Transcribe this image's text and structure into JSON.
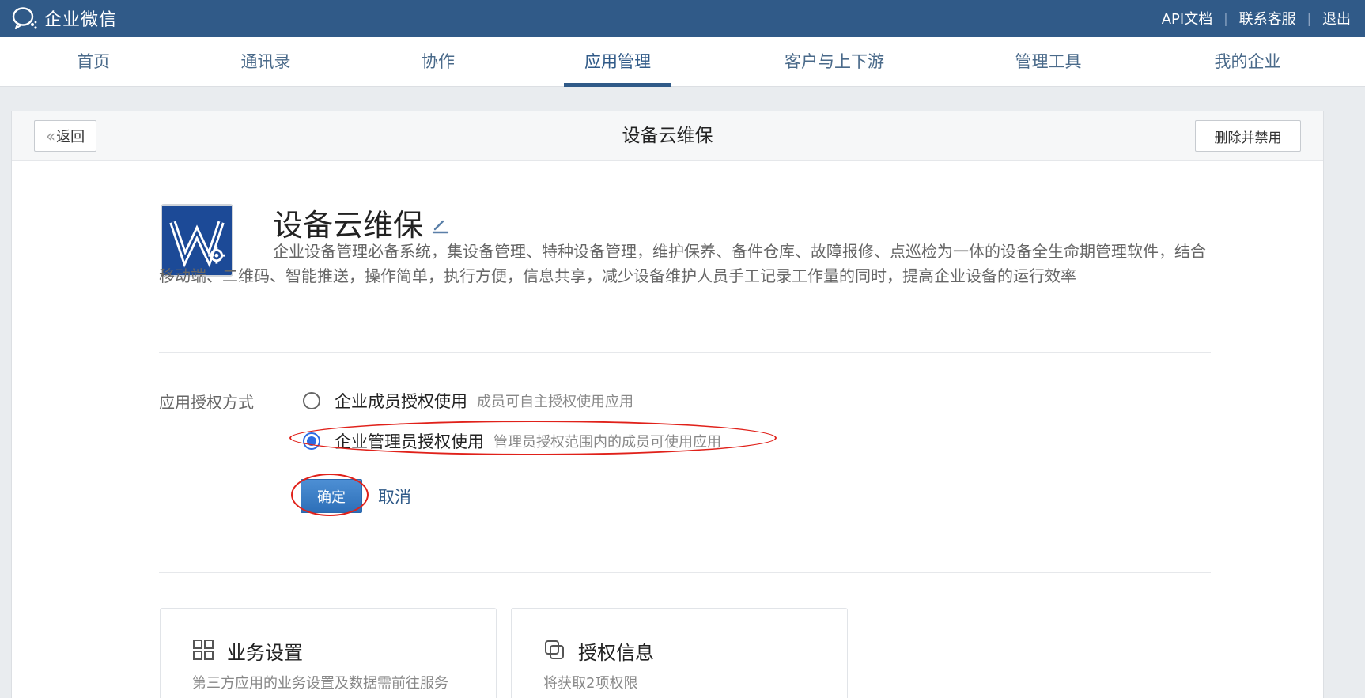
{
  "topbar": {
    "logo_text": "企业微信",
    "links": [
      "API文档",
      "联系客服",
      "退出"
    ]
  },
  "nav": {
    "items": [
      "首页",
      "通讯录",
      "协作",
      "应用管理",
      "客户与上下游",
      "管理工具",
      "我的企业"
    ],
    "active": "应用管理"
  },
  "header": {
    "back_label": "返回",
    "title": "设备云维保",
    "delete_label": "删除并禁用"
  },
  "app": {
    "name": "设备云维保",
    "description": "企业设备管理必备系统，集设备管理、特种设备管理，维护保养、备件仓库、故障报修、点巡检为一体的设备全生命期管理软件，结合移动端、二维码、智能推送，操作简单，执行方便，信息共享，减少设备维护人员手工记录工作量的同时，提高企业设备的运行效率"
  },
  "auth": {
    "label": "应用授权方式",
    "options": [
      {
        "title": "企业成员授权使用",
        "hint": "成员可自主授权使用应用",
        "checked": false
      },
      {
        "title": "企业管理员授权使用",
        "hint": "管理员授权范围内的成员可使用应用",
        "checked": true
      }
    ],
    "confirm_label": "确定",
    "cancel_label": "取消"
  },
  "cards": [
    {
      "title": "业务设置",
      "desc": "第三方应用的业务设置及数据需前往服务",
      "icon": "grid-icon"
    },
    {
      "title": "授权信息",
      "desc": "将获取2项权限",
      "icon": "copy-icon"
    }
  ],
  "colors": {
    "topbar": "#305a88",
    "accent": "#2d6be3",
    "annotation": "#e0211a"
  }
}
